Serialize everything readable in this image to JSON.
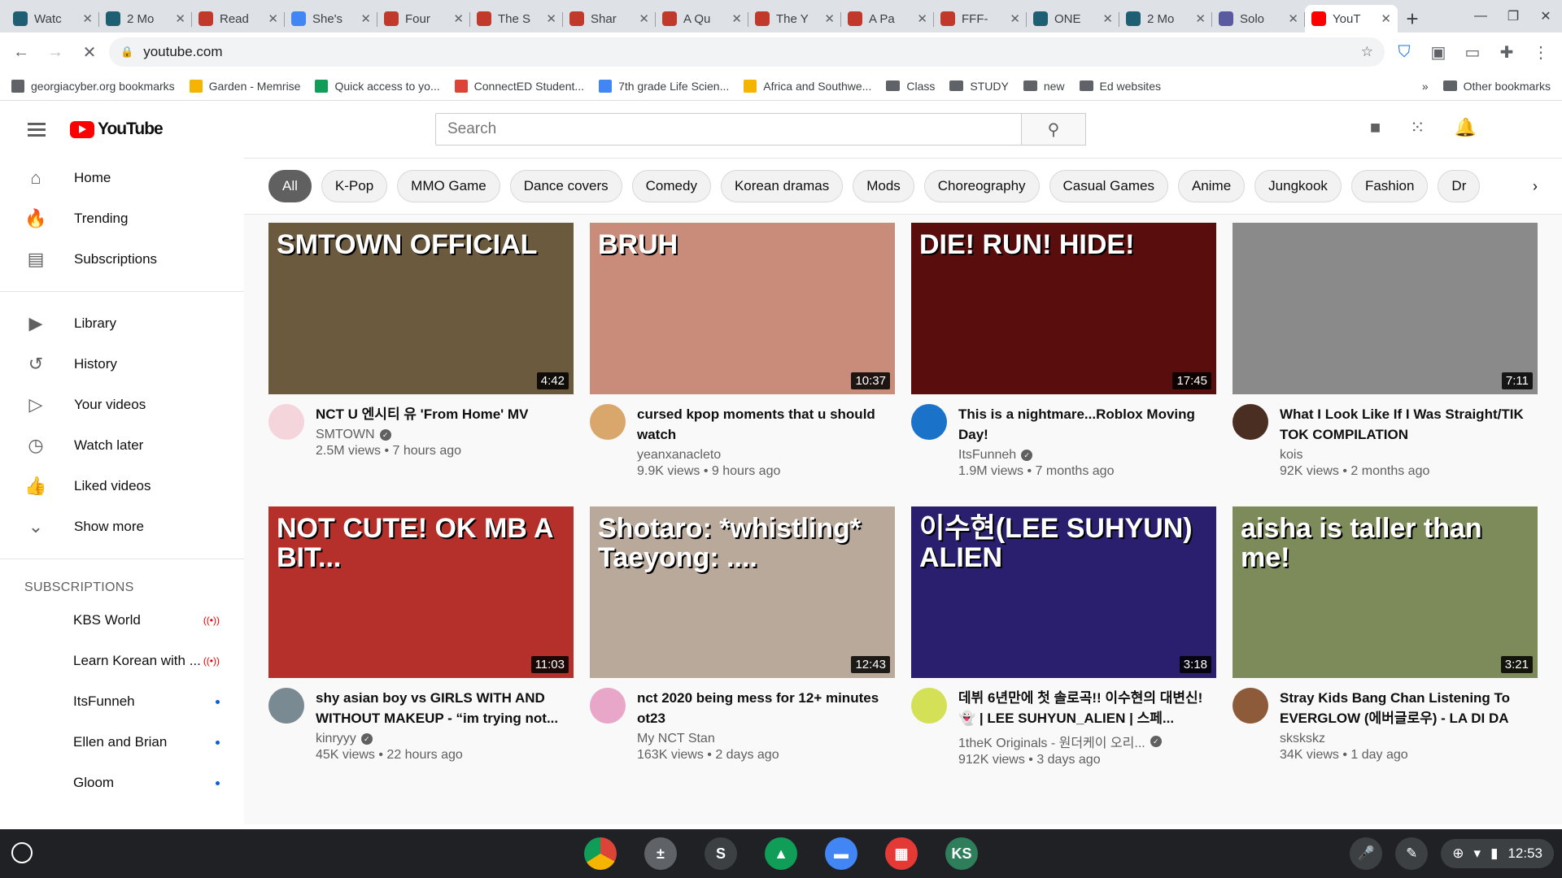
{
  "browser": {
    "tabs": [
      {
        "label": "Watc",
        "color": "#1e5f74"
      },
      {
        "label": "2 Mo",
        "color": "#1e5f74"
      },
      {
        "label": "Read",
        "color": "#c0392b"
      },
      {
        "label": "She's",
        "color": "#4285f4"
      },
      {
        "label": "Four",
        "color": "#c0392b"
      },
      {
        "label": "The S",
        "color": "#c0392b"
      },
      {
        "label": "Shar",
        "color": "#c0392b"
      },
      {
        "label": "A Qu",
        "color": "#c0392b"
      },
      {
        "label": "The Y",
        "color": "#c0392b"
      },
      {
        "label": "A Pa",
        "color": "#c0392b"
      },
      {
        "label": "FFF-",
        "color": "#c0392b"
      },
      {
        "label": "ONE",
        "color": "#1e5f74"
      },
      {
        "label": "2 Mo",
        "color": "#1e5f74"
      },
      {
        "label": "Solo",
        "color": "#5a5aa0"
      },
      {
        "label": "YouT",
        "color": "#ff0000"
      }
    ],
    "close_glyph": "✕",
    "new_tab_glyph": "+",
    "url": "youtube.com",
    "bookmarks": [
      {
        "label": "georgiacyber.org bookmarks",
        "color": "#5f6368"
      },
      {
        "label": "Garden - Memrise",
        "color": "#f4b400"
      },
      {
        "label": "Quick access to yo...",
        "color": "#0f9d58"
      },
      {
        "label": "ConnectED Student...",
        "color": "#db4437"
      },
      {
        "label": "7th grade Life Scien...",
        "color": "#4285f4"
      },
      {
        "label": "Africa and Southwe...",
        "color": "#f4b400"
      },
      {
        "label": "Class",
        "color": "folder"
      },
      {
        "label": "STUDY",
        "color": "folder"
      },
      {
        "label": "new",
        "color": "folder"
      },
      {
        "label": "Ed websites",
        "color": "folder"
      }
    ],
    "more_bookmarks": "»",
    "other_bookmarks": "Other bookmarks"
  },
  "youtube": {
    "logo_text": "YouTube",
    "search_placeholder": "Search",
    "sidebar": {
      "primary": [
        {
          "label": "Home",
          "icon": "⌂"
        },
        {
          "label": "Trending",
          "icon": "🔥"
        },
        {
          "label": "Subscriptions",
          "icon": "▤"
        }
      ],
      "secondary": [
        {
          "label": "Library",
          "icon": "▶"
        },
        {
          "label": "History",
          "icon": "↺"
        },
        {
          "label": "Your videos",
          "icon": "▷"
        },
        {
          "label": "Watch later",
          "icon": "◷"
        },
        {
          "label": "Liked videos",
          "icon": "👍"
        },
        {
          "label": "Show more",
          "icon": "⌄"
        }
      ],
      "subscriptions_heading": "SUBSCRIPTIONS",
      "subscriptions": [
        {
          "label": "KBS World",
          "status": "live"
        },
        {
          "label": "Learn Korean with ...",
          "status": "live"
        },
        {
          "label": "ItsFunneh",
          "status": "new"
        },
        {
          "label": "Ellen and Brian",
          "status": "new"
        },
        {
          "label": "Gloom",
          "status": "new"
        }
      ],
      "live_glyph": "((•))"
    },
    "chips": [
      "All",
      "K-Pop",
      "MMO Game",
      "Dance covers",
      "Comedy",
      "Korean dramas",
      "Mods",
      "Choreography",
      "Casual Games",
      "Anime",
      "Jungkook",
      "Fashion",
      "Dr"
    ],
    "chip_next": "›",
    "videos": [
      {
        "title": "NCT U 엔시티 유 'From Home' MV",
        "channel": "SMTOWN",
        "verified": true,
        "stats": "2.5M views • 7 hours ago",
        "duration": "4:42",
        "thumb_text": "SMTOWN OFFICIAL",
        "thumb_bg": "#6b5a3e",
        "avatar": "#f5d5dc"
      },
      {
        "title": "cursed kpop moments that u should watch",
        "channel": "yeanxanacleto",
        "verified": false,
        "stats": "9.9K views • 9 hours ago",
        "duration": "10:37",
        "thumb_text": "BRUH",
        "thumb_bg": "#c98c7a",
        "avatar": "#d9a66b"
      },
      {
        "title": "This is a nightmare...Roblox Moving Day!",
        "channel": "ItsFunneh",
        "verified": true,
        "stats": "1.9M views • 7 months ago",
        "duration": "17:45",
        "thumb_text": "DIE! RUN! HIDE!",
        "thumb_bg": "#5a0d0d",
        "avatar": "#1a73c8"
      },
      {
        "title": "What I Look Like If I Was Straight/TIK TOK COMPILATION",
        "channel": "kois",
        "verified": false,
        "stats": "92K views • 2 months ago",
        "duration": "7:11",
        "thumb_text": "",
        "thumb_bg": "#8a8a8a",
        "avatar": "#4a2e22"
      },
      {
        "title": "shy asian boy vs GIRLS WITH AND WITHOUT MAKEUP - “im trying not...",
        "channel": "kinryyy",
        "verified": true,
        "stats": "45K views • 22 hours ago",
        "duration": "11:03",
        "thumb_text": "NOT CUTE! OK MB A BIT...",
        "thumb_bg": "#b5302a",
        "avatar": "#7a8a92"
      },
      {
        "title": "nct 2020 being mess for 12+ minutes ot23",
        "channel": "My NCT Stan",
        "verified": false,
        "stats": "163K views • 2 days ago",
        "duration": "12:43",
        "thumb_text": "Shotaro: *whistling*   Taeyong: ....",
        "thumb_bg": "#b8a99a",
        "avatar": "#e8a6c8"
      },
      {
        "title": "데뷔 6년만에 첫 솔로곡!! 이수현의 대변신!👻 | LEE SUHYUN_ALIEN | 스페...",
        "channel": "1theK Originals - 원더케이 오리...",
        "verified": true,
        "stats": "912K views • 3 days ago",
        "duration": "3:18",
        "thumb_text": "이수현(LEE SUHYUN) ALIEN",
        "thumb_bg": "#2a1f6e",
        "avatar": "#d4e157"
      },
      {
        "title": "Stray Kids Bang Chan Listening To EVERGLOW (에버글로우) - LA DI DA",
        "channel": "skskskz",
        "verified": false,
        "stats": "34K views • 1 day ago",
        "duration": "3:21",
        "thumb_text": "aisha is taller than me!",
        "thumb_bg": "#7d8b5a",
        "avatar": "#8d5a3a"
      }
    ]
  },
  "shelf": {
    "apps": [
      {
        "name": "chrome",
        "glyph": "",
        "color": "#db4437"
      },
      {
        "name": "calculator",
        "glyph": "±",
        "color": "#5f6368"
      },
      {
        "name": "s-app",
        "glyph": "S",
        "color": "#3c4043"
      },
      {
        "name": "drive",
        "glyph": "▲",
        "color": "#0f9d58"
      },
      {
        "name": "files",
        "glyph": "▬",
        "color": "#4285f4"
      },
      {
        "name": "clapper",
        "glyph": "▦",
        "color": "#e53935"
      },
      {
        "name": "ks-app",
        "glyph": "KS",
        "color": "#2e7d5b"
      }
    ],
    "clock": "12:53"
  }
}
